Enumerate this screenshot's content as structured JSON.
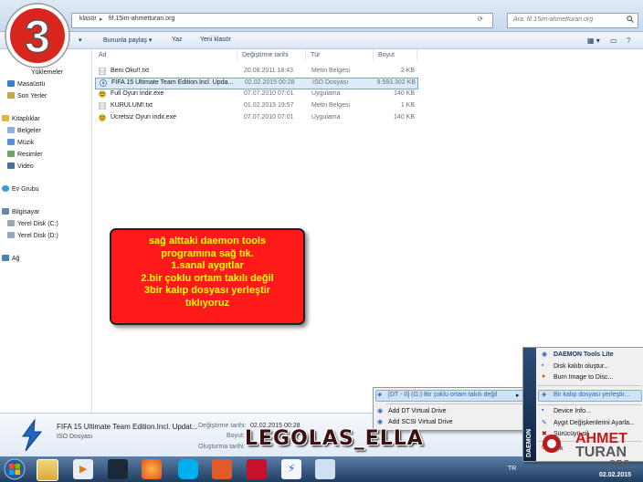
{
  "step_badge": "3",
  "address_bar": {
    "segments": [
      "klasör",
      "fif.15im-ahmetturan.org"
    ],
    "search_placeholder": "Ara: fif.15im-ahmetturan.org"
  },
  "toolbar": {
    "share_label": "Bununla paylaş",
    "print_label": "Yaz",
    "new_folder_label": "Yeni klasör"
  },
  "nav": {
    "items": [
      {
        "label": "Yüklemeler"
      },
      {
        "label": "Masaüstü"
      },
      {
        "label": "Son Yerler"
      },
      {
        "label": "Kitaplıklar"
      },
      {
        "label": "Belgeler"
      },
      {
        "label": "Müzik"
      },
      {
        "label": "Resimler"
      },
      {
        "label": "Video"
      },
      {
        "label": "Ev Grubu"
      },
      {
        "label": "Bilgisayar"
      },
      {
        "label": "Yerel Disk (C:)"
      },
      {
        "label": "Yerel Disk (D:)"
      },
      {
        "label": "Ağ"
      }
    ]
  },
  "columns": {
    "name": "Ad",
    "date": "Değiştirme tarihi",
    "type": "Tür",
    "size": "Boyut"
  },
  "files": [
    {
      "name": "Beni Oku!!.txt",
      "date": "20.08.2011 18:43",
      "type": "Metin Belgesi",
      "size": "2 KB",
      "icon": "text-file-icon"
    },
    {
      "name": "FIFA 15 Ultimate Team Edition.Incl. Upda...",
      "date": "02.02.2015 00:28",
      "type": "ISO Dosyası",
      "size": "9.593.302 KB",
      "icon": "daemon-iso-icon"
    },
    {
      "name": "Full Oyun İndir.exe",
      "date": "07.07.2010 07:01",
      "type": "Uygulama",
      "size": "140 KB",
      "icon": "smiley-exe-icon"
    },
    {
      "name": "KURULUM!.txt",
      "date": "01.02.2015 19:57",
      "type": "Metin Belgesi",
      "size": "1 KB",
      "icon": "text-file-icon"
    },
    {
      "name": "Ücretsiz Oyun indir.exe",
      "date": "07.07.2010 07:01",
      "type": "Uygulama",
      "size": "140 KB",
      "icon": "smiley-exe-icon"
    }
  ],
  "callout_lines": [
    "sağ alttaki daemon tools",
    "programına sağ tık.",
    "1.sanal aygıtlar",
    "2.bir çoklu ortam takılı değil",
    "3bir kalıp dosyası yerleştir",
    "tıklıyoruz"
  ],
  "details": {
    "file_name": "FIFA 15 Ultimate Team Edition.Incl. Updat...",
    "file_type": "ISO Dosyası",
    "modified_label": "Değiştirme tarihi:",
    "modified_value": "02.02.2015 00:28",
    "size_label": "Boyut:",
    "created_label": "Oluşturma tarihi:"
  },
  "context_menu": {
    "items": [
      {
        "label": "[DT - 0] (G:) Bir çoklu ortam takılı değil",
        "arrow": "▸"
      },
      {
        "label": "Add DT Virtual Drive"
      },
      {
        "label": "Add SCSI Virtual Drive"
      }
    ]
  },
  "daemon_menu": {
    "title": "DAEMON Tools Lite",
    "items": [
      {
        "label": "Disk kalıbı oluştur..."
      },
      {
        "label": "Burn Image to Disc..."
      },
      {
        "label": "Device Info..."
      },
      {
        "label": "Aygıt Değişkenlerini Ayarla..."
      },
      {
        "label": "Sürücüyü sil"
      },
      {
        "label": "Çık"
      }
    ],
    "side_text": "DAEMON",
    "submenu_item": "Bir kalıp dosyası yerleştir..."
  },
  "watermark": "LEGOLAS_ELLA",
  "logo": {
    "line1": "AHMET",
    "line2": "TURAN",
    "line3": ".ORG",
    "date": "02.02.2015"
  },
  "tray": {
    "lang": "TR"
  },
  "colors": {
    "callout_bg": "#ff1a1a",
    "callout_text": "#ffff00",
    "selection": "#dcebfc",
    "menu_highlight": "#cfe3f8"
  }
}
